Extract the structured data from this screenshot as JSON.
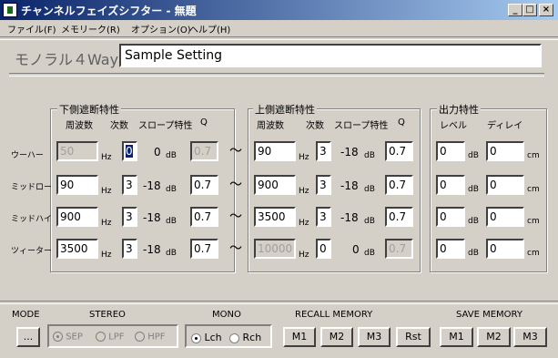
{
  "window": {
    "title": "チャンネルフェイズシフター - 無題",
    "minimize": "_",
    "maximize": "□",
    "close": "×"
  },
  "menu": [
    "ファイル(F)",
    "メモリーク(R)",
    "オプション(O)",
    "ヘルプ(H)"
  ],
  "header": {
    "model_label": "モノラル４Way",
    "setting_name": "Sample Setting"
  },
  "groups": {
    "low": {
      "title": "下側遮断特性",
      "headers": [
        "周波数",
        "次数",
        "スロープ特性",
        "Q"
      ]
    },
    "high": {
      "title": "上側遮断特性",
      "headers": [
        "周波数",
        "次数",
        "スロープ特性",
        "Q"
      ]
    },
    "out": {
      "title": "出力特性",
      "headers": [
        "レベル",
        "ディレイ"
      ]
    }
  },
  "units": {
    "hz": "Hz",
    "db": "dB",
    "cm": "cm"
  },
  "rows": [
    {
      "label": "ウーハー",
      "low": {
        "freq": "50",
        "order": "0",
        "slope": "0",
        "q": "0.7"
      },
      "high": {
        "freq": "90",
        "order": "3",
        "slope": "-18",
        "q": "0.7"
      },
      "level": "0",
      "delay": "0"
    },
    {
      "label": "ミッドロー",
      "low": {
        "freq": "90",
        "order": "3",
        "slope": "-18",
        "q": "0.7"
      },
      "high": {
        "freq": "900",
        "order": "3",
        "slope": "-18",
        "q": "0.7"
      },
      "level": "0",
      "delay": "0"
    },
    {
      "label": "ミッドハイ",
      "low": {
        "freq": "900",
        "order": "3",
        "slope": "-18",
        "q": "0.7"
      },
      "high": {
        "freq": "3500",
        "order": "3",
        "slope": "-18",
        "q": "0.7"
      },
      "level": "0",
      "delay": "0"
    },
    {
      "label": "ツィーター",
      "low": {
        "freq": "3500",
        "order": "3",
        "slope": "-18",
        "q": "0.7"
      },
      "high": {
        "freq": "10000",
        "order": "0",
        "slope": "0",
        "q": "0.7"
      },
      "level": "0",
      "delay": "0"
    }
  ],
  "tilde": "～",
  "bottom": {
    "mode_label": "MODE",
    "mode_button": "...",
    "stereo_label": "STEREO",
    "stereo_options": [
      "SEP",
      "LPF",
      "HPF"
    ],
    "mono_label": "MONO",
    "mono_options": [
      "Lch",
      "Rch"
    ],
    "recall_label": "RECALL MEMORY",
    "recall_buttons": [
      "M1",
      "M2",
      "M3",
      "Rst"
    ],
    "save_label": "SAVE MEMORY",
    "save_buttons": [
      "M1",
      "M2",
      "M3"
    ]
  }
}
